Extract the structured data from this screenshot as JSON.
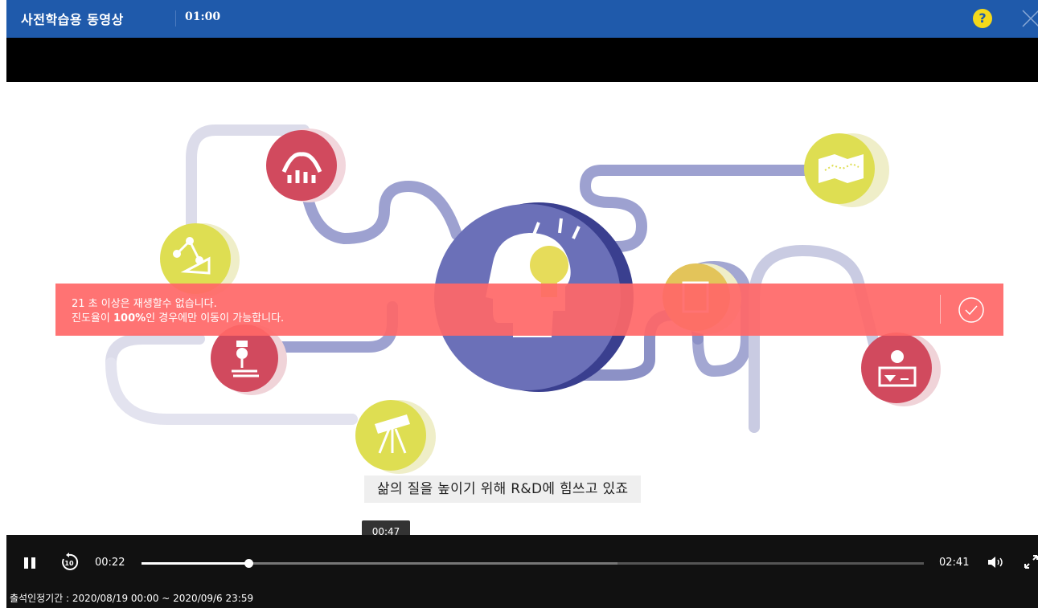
{
  "header": {
    "title": "사전학습용 동영상",
    "timer": "01:00",
    "help_glyph": "?",
    "help_icon": "question-circle-icon",
    "close_icon": "close-icon",
    "bar_color": "#1f5aab"
  },
  "warning": {
    "line1": "21 초 이상은 재생할수 없습니다.",
    "line2_pre": "진도율이 ",
    "line2_bold": "100%",
    "line2_post": "인 경우에만 이동이 가능합니다.",
    "confirm_icon": "check-circle-icon",
    "color": "#ff6767"
  },
  "video": {
    "caption": "삶의 질을 높이기 위해 R&D에 힘쓰고 있죠",
    "icons": [
      "chart-icon",
      "geometry-icon",
      "microscope-icon",
      "telescope-icon",
      "lightbulb-head-icon",
      "map-icon",
      "document-icon",
      "presentation-icon"
    ]
  },
  "player": {
    "tooltip_time": "00:47",
    "current_time": "00:22",
    "duration": "02:41",
    "played_fraction": 0.137,
    "buffered_fraction": 0.608,
    "pause_icon": "pause-icon",
    "rewind_icon": "rewind-10-icon",
    "rewind_label": "10",
    "volume_icon": "volume-icon",
    "fullscreen_icon": "fullscreen-icon"
  },
  "footer": {
    "attendance_period": "출석인정기간 : 2020/08/19 00:00 ~ 2020/09/6 23:59"
  }
}
